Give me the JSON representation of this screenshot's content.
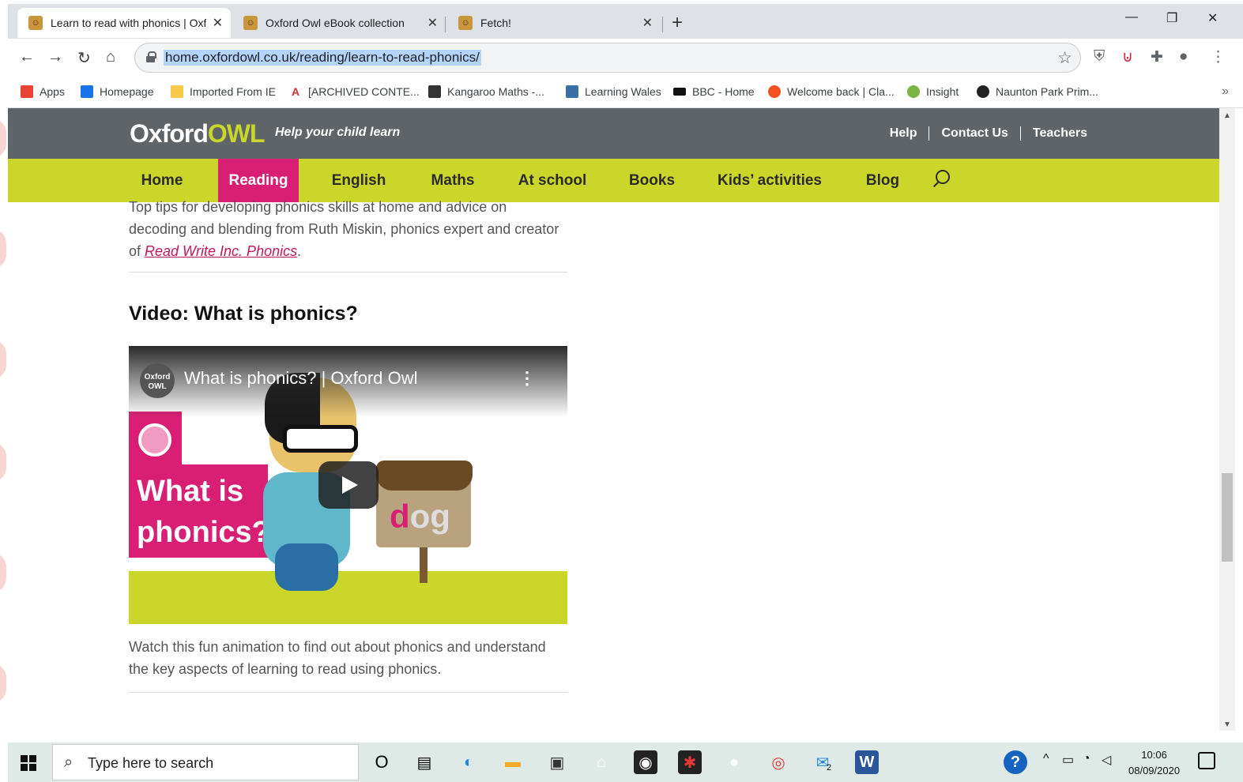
{
  "browser": {
    "tabs": [
      {
        "title": "Learn to read with phonics | Oxfo",
        "active": true
      },
      {
        "title": "Oxford Owl eBook collection",
        "active": false
      },
      {
        "title": "Fetch!",
        "active": false
      }
    ],
    "close_glyph": "✕",
    "new_tab_glyph": "+",
    "window_controls": {
      "minimize": "—",
      "restore": "❐",
      "close": "✕"
    },
    "nav": {
      "back": "←",
      "forward": "→",
      "reload": "↻",
      "home": "⌂"
    },
    "url": "home.oxfordowl.co.uk/reading/learn-to-read-phonics/",
    "star": "☆",
    "bookmarks": [
      {
        "label": "Apps",
        "color": "#ea4335"
      },
      {
        "label": "Homepage",
        "color": "#1a73e8"
      },
      {
        "label": "Imported From IE",
        "color": "#f9c846"
      },
      {
        "label": "[ARCHIVED CONTE...",
        "color": "#e8eaed"
      },
      {
        "label": "Kangaroo Maths -...",
        "color": "#333333"
      },
      {
        "label": "Learning Wales",
        "color": "#3a6ea5"
      },
      {
        "label": "BBC - Home",
        "color": "#111111"
      },
      {
        "label": "Welcome back | Cla...",
        "color": "#f4511e"
      },
      {
        "label": "Insight",
        "color": "#7cb342"
      },
      {
        "label": "Naunton Park Prim...",
        "color": "#222222"
      }
    ],
    "bookmarks_more": "»"
  },
  "site": {
    "logo_main": "Oxford",
    "logo_owl": "OWL",
    "tagline": "Help your child learn",
    "top_links": [
      "Help",
      "Contact Us",
      "Teachers"
    ],
    "nav": [
      "Home",
      "Reading",
      "English",
      "Maths",
      "At school",
      "Books",
      "Kids’ activities",
      "Blog"
    ],
    "active_nav": "Reading",
    "accent": "#d81f73",
    "nav_color": "#cbd62a",
    "header_color": "#5f6469"
  },
  "content": {
    "intro_text": "Top tips for developing phonics skills at home and advice on decoding and blending from Ruth Miskin, phonics expert and creator of ",
    "intro_link": "Read Write Inc. Phonics",
    "intro_end": ".",
    "heading": "Video: What is phonics?",
    "video": {
      "channel": "Oxford OWL",
      "title": "What is phonics? | Oxford Owl",
      "menu": "⋮",
      "overlay_text_1": "What is",
      "overlay_text_2": "phonics?",
      "sign_first": "d",
      "sign_rest": "og"
    },
    "caption": "Watch this fun animation to find out about phonics and understand the key aspects of learning to read using phonics."
  },
  "taskbar": {
    "search_placeholder": "Type here to search",
    "time": "10:06",
    "date": "08/09/2020",
    "mail_badge": "2",
    "word_letter": "W",
    "help_glyph": "?",
    "tray_chevron": "^",
    "cortana": "O"
  }
}
